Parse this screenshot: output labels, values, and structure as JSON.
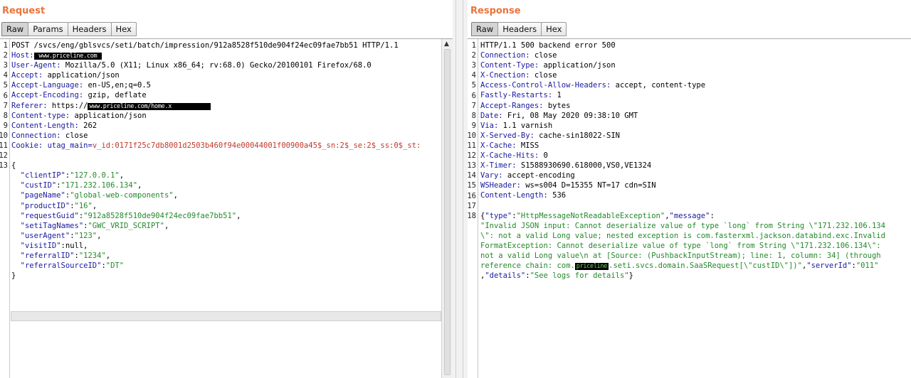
{
  "request": {
    "title": "Request",
    "tabs": [
      {
        "label": "Raw",
        "active": true
      },
      {
        "label": "Params"
      },
      {
        "label": "Headers"
      },
      {
        "label": "Hex"
      }
    ],
    "lines": [
      {
        "n": "1",
        "parts": [
          {
            "t": "POST /svcs/eng/gblsvcs/seti/batch/impression/912a8528f510de904f24ec09fae7bb51 HTTP/1.1",
            "c": "p"
          }
        ]
      },
      {
        "n": "2",
        "parts": [
          {
            "t": "Host:",
            "c": "hk"
          },
          {
            "t": " www.priceline.com ",
            "c": "redact"
          }
        ]
      },
      {
        "n": "3",
        "parts": [
          {
            "t": "User-Agent:",
            "c": "hk"
          },
          {
            "t": " Mozilla/5.0 (X11; Linux x86_64; rv:68.0) Gecko/20100101 Firefox/68.0",
            "c": "p"
          }
        ]
      },
      {
        "n": "4",
        "parts": [
          {
            "t": "Accept:",
            "c": "hk"
          },
          {
            "t": " application/json",
            "c": "p"
          }
        ]
      },
      {
        "n": "5",
        "parts": [
          {
            "t": "Accept-Language:",
            "c": "hk"
          },
          {
            "t": " en-US,en;q=0.5",
            "c": "p"
          }
        ]
      },
      {
        "n": "6",
        "parts": [
          {
            "t": "Accept-Encoding:",
            "c": "hk"
          },
          {
            "t": " gzip, deflate",
            "c": "p"
          }
        ]
      },
      {
        "n": "7",
        "parts": [
          {
            "t": "Referer:",
            "c": "hk"
          },
          {
            "t": " https://",
            "c": "p"
          },
          {
            "t": "www.priceline.com/home.x           ",
            "c": "redact"
          }
        ]
      },
      {
        "n": "8",
        "parts": [
          {
            "t": "Content-type:",
            "c": "hk"
          },
          {
            "t": " application/json",
            "c": "p"
          }
        ]
      },
      {
        "n": "9",
        "parts": [
          {
            "t": "Content-Length:",
            "c": "hk"
          },
          {
            "t": " 262",
            "c": "p"
          }
        ]
      },
      {
        "n": "10",
        "parts": [
          {
            "t": "Connection:",
            "c": "hk"
          },
          {
            "t": " close",
            "c": "p"
          }
        ]
      },
      {
        "n": "11",
        "parts": [
          {
            "t": "Cookie:",
            "c": "hk"
          },
          {
            "t": " utag_main=",
            "c": "hk"
          },
          {
            "t": "v_id:0171f25c7db8001d2503b460f94e00044001f00900a45$_sn:2$_se:2$_ss:0$_st:",
            "c": "ck"
          }
        ]
      },
      {
        "n": "12",
        "parts": [
          {
            "t": "",
            "c": "p"
          }
        ]
      },
      {
        "n": "13",
        "parts": [
          {
            "t": "{",
            "c": "p"
          }
        ]
      },
      {
        "n": "",
        "parts": [
          {
            "t": "  \"clientIP\"",
            "c": "jk"
          },
          {
            "t": ":",
            "c": "jp"
          },
          {
            "t": "\"127.0.0.1\"",
            "c": "js"
          },
          {
            "t": ",",
            "c": "jp"
          }
        ]
      },
      {
        "n": "",
        "parts": [
          {
            "t": "  \"custID\"",
            "c": "jk"
          },
          {
            "t": ":",
            "c": "jp"
          },
          {
            "t": "\"171.232.106.134\"",
            "c": "js"
          },
          {
            "t": ",",
            "c": "jp"
          }
        ]
      },
      {
        "n": "",
        "parts": [
          {
            "t": "  \"pageName\"",
            "c": "jk"
          },
          {
            "t": ":",
            "c": "jp"
          },
          {
            "t": "\"global-web-components\"",
            "c": "js"
          },
          {
            "t": ",",
            "c": "jp"
          }
        ]
      },
      {
        "n": "",
        "parts": [
          {
            "t": "  \"productID\"",
            "c": "jk"
          },
          {
            "t": ":",
            "c": "jp"
          },
          {
            "t": "\"16\"",
            "c": "js"
          },
          {
            "t": ",",
            "c": "jp"
          }
        ]
      },
      {
        "n": "",
        "parts": [
          {
            "t": "  \"requestGuid\"",
            "c": "jk"
          },
          {
            "t": ":",
            "c": "jp"
          },
          {
            "t": "\"912a8528f510de904f24ec09fae7bb51\"",
            "c": "js"
          },
          {
            "t": ",",
            "c": "jp"
          }
        ]
      },
      {
        "n": "",
        "parts": [
          {
            "t": "  \"setiTagNames\"",
            "c": "jk"
          },
          {
            "t": ":",
            "c": "jp"
          },
          {
            "t": "\"GWC_VRID_SCRIPT\"",
            "c": "js"
          },
          {
            "t": ",",
            "c": "jp"
          }
        ]
      },
      {
        "n": "",
        "parts": [
          {
            "t": "  \"userAgent\"",
            "c": "jk"
          },
          {
            "t": ":",
            "c": "jp"
          },
          {
            "t": "\"123\"",
            "c": "js"
          },
          {
            "t": ",",
            "c": "jp"
          }
        ]
      },
      {
        "n": "",
        "parts": [
          {
            "t": "  \"visitID\"",
            "c": "jk"
          },
          {
            "t": ":null,",
            "c": "jp"
          }
        ]
      },
      {
        "n": "",
        "parts": [
          {
            "t": "  \"referralID\"",
            "c": "jk"
          },
          {
            "t": ":",
            "c": "jp"
          },
          {
            "t": "\"1234\"",
            "c": "js"
          },
          {
            "t": ",",
            "c": "jp"
          }
        ]
      },
      {
        "n": "",
        "parts": [
          {
            "t": "  \"referralSourceID\"",
            "c": "jk"
          },
          {
            "t": ":",
            "c": "jp"
          },
          {
            "t": "\"DT\"",
            "c": "js"
          }
        ]
      },
      {
        "n": "",
        "parts": [
          {
            "t": "}",
            "c": "jp"
          }
        ]
      }
    ]
  },
  "response": {
    "title": "Response",
    "tabs": [
      {
        "label": "Raw",
        "active": true
      },
      {
        "label": "Headers"
      },
      {
        "label": "Hex"
      }
    ],
    "lines": [
      {
        "n": "1",
        "parts": [
          {
            "t": "HTTP/1.1 500 backend error 500",
            "c": "p"
          }
        ]
      },
      {
        "n": "2",
        "parts": [
          {
            "t": "Connection:",
            "c": "hk"
          },
          {
            "t": " close",
            "c": "p"
          }
        ]
      },
      {
        "n": "3",
        "parts": [
          {
            "t": "Content-Type:",
            "c": "hk"
          },
          {
            "t": " application/json",
            "c": "p"
          }
        ]
      },
      {
        "n": "4",
        "parts": [
          {
            "t": "X-Cnection:",
            "c": "hk"
          },
          {
            "t": " close",
            "c": "p"
          }
        ]
      },
      {
        "n": "5",
        "parts": [
          {
            "t": "Access-Control-Allow-Headers:",
            "c": "hk"
          },
          {
            "t": " accept, content-type",
            "c": "p"
          }
        ]
      },
      {
        "n": "6",
        "parts": [
          {
            "t": "Fastly-Restarts:",
            "c": "hk"
          },
          {
            "t": " 1",
            "c": "p"
          }
        ]
      },
      {
        "n": "7",
        "parts": [
          {
            "t": "Accept-Ranges:",
            "c": "hk"
          },
          {
            "t": " bytes",
            "c": "p"
          }
        ]
      },
      {
        "n": "8",
        "parts": [
          {
            "t": "Date:",
            "c": "hk"
          },
          {
            "t": " Fri, 08 May 2020 09:38:10 GMT",
            "c": "p"
          }
        ]
      },
      {
        "n": "9",
        "parts": [
          {
            "t": "Via:",
            "c": "hk"
          },
          {
            "t": " 1.1 varnish",
            "c": "p"
          }
        ]
      },
      {
        "n": "10",
        "parts": [
          {
            "t": "X-Served-By:",
            "c": "hk"
          },
          {
            "t": " cache-sin18022-SIN",
            "c": "p"
          }
        ]
      },
      {
        "n": "11",
        "parts": [
          {
            "t": "X-Cache:",
            "c": "hk"
          },
          {
            "t": " MISS",
            "c": "p"
          }
        ]
      },
      {
        "n": "12",
        "parts": [
          {
            "t": "X-Cache-Hits:",
            "c": "hk"
          },
          {
            "t": " 0",
            "c": "p"
          }
        ]
      },
      {
        "n": "13",
        "parts": [
          {
            "t": "X-Timer:",
            "c": "hk"
          },
          {
            "t": " S1588930690.618000,VS0,VE1324",
            "c": "p"
          }
        ]
      },
      {
        "n": "14",
        "parts": [
          {
            "t": "Vary:",
            "c": "hk"
          },
          {
            "t": " accept-encoding",
            "c": "p"
          }
        ]
      },
      {
        "n": "15",
        "parts": [
          {
            "t": "WSHeader:",
            "c": "hk"
          },
          {
            "t": " ws=s004 D=15355 NT=17 cdn=SIN",
            "c": "p"
          }
        ]
      },
      {
        "n": "16",
        "parts": [
          {
            "t": "Content-Length:",
            "c": "hk"
          },
          {
            "t": " 536",
            "c": "p"
          }
        ]
      },
      {
        "n": "17",
        "parts": [
          {
            "t": "",
            "c": "p"
          }
        ]
      },
      {
        "n": "18",
        "parts": [
          {
            "t": "{",
            "c": "jp"
          },
          {
            "t": "\"type\"",
            "c": "jk"
          },
          {
            "t": ":",
            "c": "jp"
          },
          {
            "t": "\"HttpMessageNotReadableException\"",
            "c": "js"
          },
          {
            "t": ",",
            "c": "jp"
          },
          {
            "t": "\"message\"",
            "c": "jk"
          },
          {
            "t": ":",
            "c": "jp"
          }
        ]
      },
      {
        "n": "",
        "parts": [
          {
            "t": "\"Invalid JSON input: Cannot deserialize value of type `long` from String \\\"171.232.106.134",
            "c": "js"
          }
        ]
      },
      {
        "n": "",
        "parts": [
          {
            "t": "\\\": not a valid Long value; nested exception is com.fasterxml.jackson.databind.exc.Invalid",
            "c": "js"
          }
        ]
      },
      {
        "n": "",
        "parts": [
          {
            "t": "FormatException: Cannot deserialize value of type `long` from String \\\"171.232.106.134\\\":",
            "c": "js"
          }
        ]
      },
      {
        "n": "",
        "parts": [
          {
            "t": "not a valid Long value\\n at [Source: (PushbackInputStream); line: 1, column: 34] (through",
            "c": "js"
          }
        ]
      },
      {
        "n": "",
        "parts": [
          {
            "t": "reference chain: com.",
            "c": "js"
          },
          {
            "t": "priceline",
            "c": "redact green"
          },
          {
            "t": ".seti.svcs.domain.SaaSRequest[\\\"custID\\\"])\"",
            "c": "js"
          },
          {
            "t": ",",
            "c": "jp"
          },
          {
            "t": "\"serverId\"",
            "c": "jk"
          },
          {
            "t": ":",
            "c": "jp"
          },
          {
            "t": "\"011\"",
            "c": "js"
          }
        ]
      },
      {
        "n": "",
        "parts": [
          {
            "t": ",",
            "c": "jp"
          },
          {
            "t": "\"details\"",
            "c": "jk"
          },
          {
            "t": ":",
            "c": "jp"
          },
          {
            "t": "\"See logs for details\"",
            "c": "js"
          },
          {
            "t": "}",
            "c": "jp"
          }
        ]
      }
    ]
  }
}
